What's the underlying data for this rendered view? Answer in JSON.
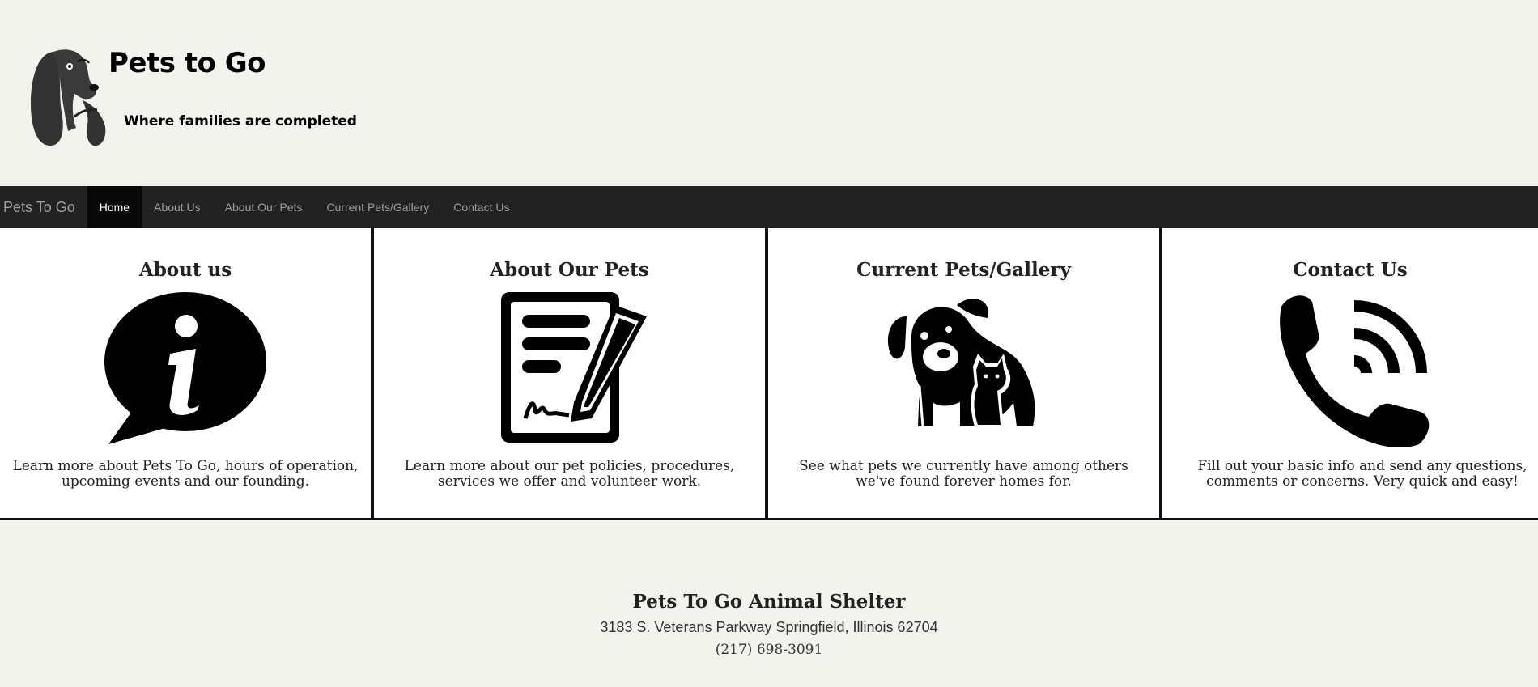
{
  "header": {
    "title": "Pets to Go",
    "tagline": "Where families are completed",
    "logo_icon": "dog-head-icon"
  },
  "nav": {
    "brand": "Pets To Go",
    "items": [
      {
        "label": "Home",
        "active": true
      },
      {
        "label": "About Us",
        "active": false
      },
      {
        "label": "About Our Pets",
        "active": false
      },
      {
        "label": "Current Pets/Gallery",
        "active": false
      },
      {
        "label": "Contact Us",
        "active": false
      }
    ]
  },
  "cards": [
    {
      "title": "About us",
      "icon": "info-speech-bubble-icon",
      "text": "Learn more about Pets To Go, hours of operation, upcoming events and our founding."
    },
    {
      "title": "About Our Pets",
      "icon": "document-signature-icon",
      "text": "Learn more about our pet policies, procedures, services we offer and volunteer work."
    },
    {
      "title": "Current Pets/Gallery",
      "icon": "dog-and-cat-icon",
      "text": "See what pets we currently have among others we've found forever homes for."
    },
    {
      "title": "Contact Us",
      "icon": "phone-call-icon",
      "text": "Fill out your basic info and send any questions, comments or concerns. Very quick and easy!"
    }
  ],
  "footer": {
    "title": "Pets To Go Animal Shelter",
    "address": "3183 S. Veterans Parkway Springfield, Illinois 62704",
    "phone": "(217) 698-3091"
  },
  "colors": {
    "page_background": "#f3f3ee",
    "navbar_background": "#222222",
    "nav_active_background": "#080808",
    "nav_text": "#9d9d9d",
    "card_border": "#111111"
  }
}
